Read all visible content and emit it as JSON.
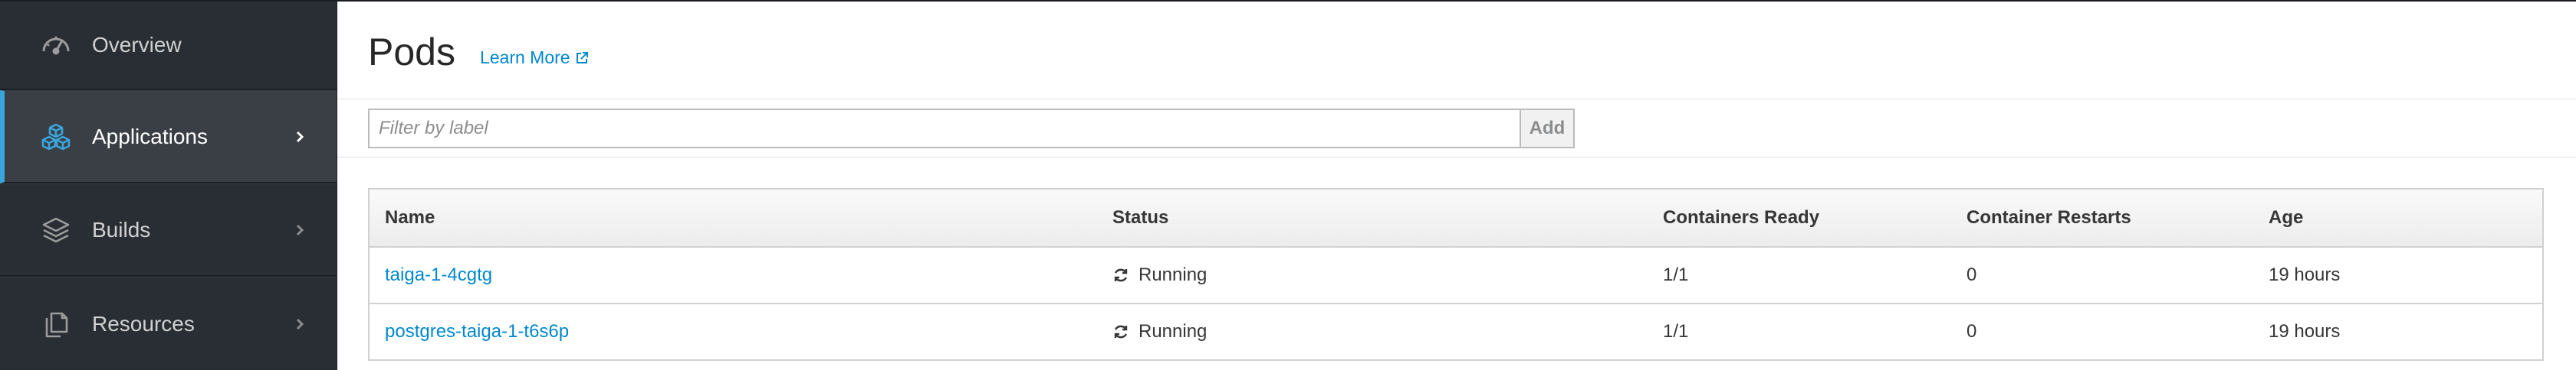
{
  "sidebar": {
    "items": [
      {
        "label": "Overview",
        "icon": "dashboard-icon",
        "active": false,
        "has_chevron": false
      },
      {
        "label": "Applications",
        "icon": "cubes-icon",
        "active": true,
        "has_chevron": true
      },
      {
        "label": "Builds",
        "icon": "layers-icon",
        "active": false,
        "has_chevron": true
      },
      {
        "label": "Resources",
        "icon": "files-icon",
        "active": false,
        "has_chevron": true
      }
    ]
  },
  "header": {
    "title": "Pods",
    "learn_more": "Learn More",
    "learn_more_icon": "external-link-icon"
  },
  "filter": {
    "placeholder": "Filter by label",
    "add_label": "Add"
  },
  "table": {
    "columns": [
      "Name",
      "Status",
      "Containers Ready",
      "Container Restarts",
      "Age"
    ],
    "rows": [
      {
        "name": "taiga-1-4cgtg",
        "status": "Running",
        "ready": "1/1",
        "restarts": "0",
        "age": "19 hours"
      },
      {
        "name": "postgres-taiga-1-t6s6p",
        "status": "Running",
        "ready": "1/1",
        "restarts": "0",
        "age": "19 hours"
      }
    ]
  },
  "colors": {
    "sidebar_bg": "#292e34",
    "active_accent": "#39a5dc",
    "link": "#0088ce"
  }
}
